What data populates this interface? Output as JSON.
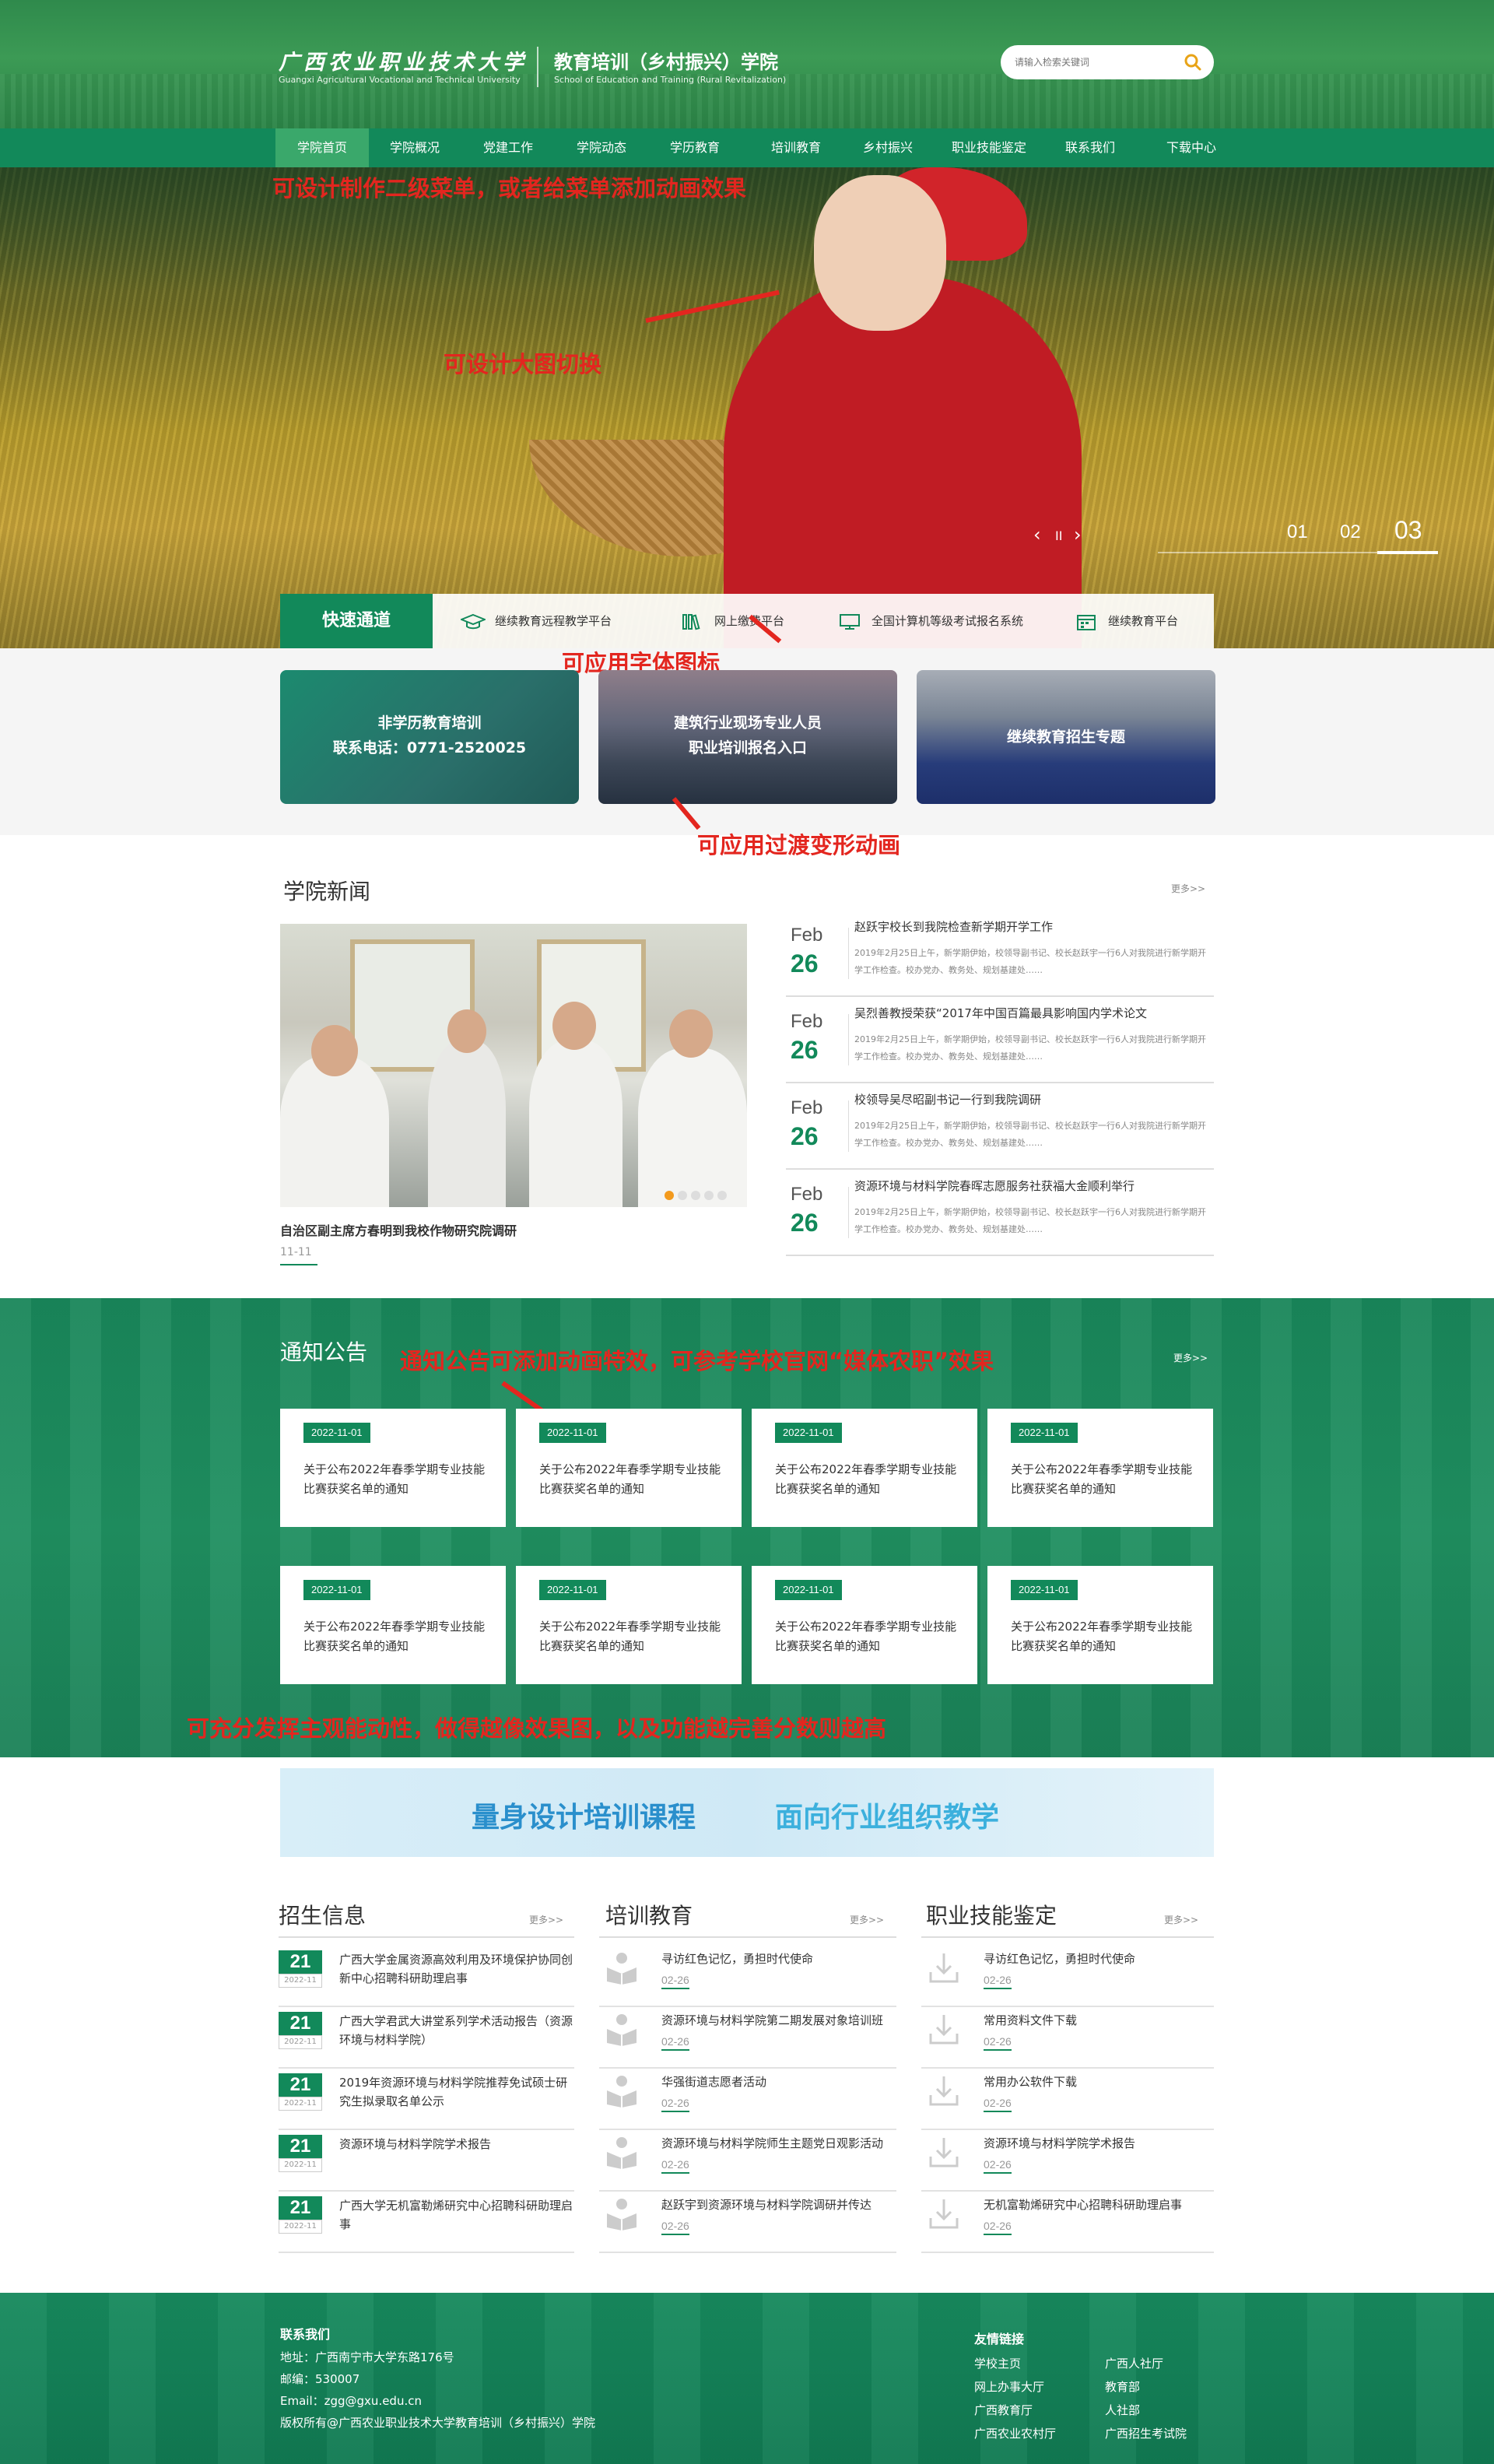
{
  "header": {
    "logo_cn": "广西农业职业技术大学",
    "logo_en": "Guangxi Agricultural Vocational and Technical University",
    "school_cn": "教育培训（乡村振兴）学院",
    "school_en": "School of Education and Training (Rural Revitalization)",
    "search_placeholder": "请输入检索关键词",
    "search_icon": "search-icon"
  },
  "nav": {
    "items": [
      {
        "label": "学院首页",
        "active": true
      },
      {
        "label": "学院概况"
      },
      {
        "label": "党建工作"
      },
      {
        "label": "学院动态"
      },
      {
        "label": "学历教育"
      },
      {
        "label": "培训教育"
      },
      {
        "label": "乡村振兴"
      },
      {
        "label": "职业技能鉴定"
      },
      {
        "label": "联系我们"
      },
      {
        "label": "下载中心"
      }
    ]
  },
  "annotations": {
    "menu_note": "可设计制作二级菜单，或者给菜单添加动画效果",
    "banner_note": "可设计大图切换",
    "icon_note": "可应用字体图标",
    "transition_note": "可应用过渡变形动画",
    "notice_note": "通知公告可添加动画特效，可参考学校官网“媒体农职”效果",
    "bottom_note": "可充分发挥主观能动性，做得越像效果图，以及功能越完善分数则越高"
  },
  "banner": {
    "prev": "‹",
    "pause": "II",
    "next": "›",
    "slides": [
      "01",
      "02",
      "03"
    ],
    "active_slide": "03"
  },
  "quick": {
    "title": "快速通道",
    "items": [
      {
        "label": "继续教育远程教学平台",
        "icon": "graduation-cap-icon"
      },
      {
        "label": "网上缴费平台",
        "icon": "books-icon"
      },
      {
        "label": "全国计算机等级考试报名系统",
        "icon": "presentation-icon"
      },
      {
        "label": "继续教育平台",
        "icon": "calendar-icon"
      }
    ]
  },
  "features": [
    {
      "line1": "非学历教育培训",
      "line2": "联系电话：0771-2520025"
    },
    {
      "line1": "建筑行业现场专业人员",
      "line2": "职业培训报名入口"
    },
    {
      "line1": "继续教育招生专题",
      "line2": ""
    }
  ],
  "news": {
    "title": "学院新闻",
    "more": "更多>>",
    "featured_caption": "自治区副主席方春明到我校作物研究院调研",
    "featured_date": "11-11",
    "items": [
      {
        "month": "Feb",
        "day": "26",
        "title": "赵跃宇校长到我院检查新学期开学工作",
        "desc": "2019年2月25日上午，新学期伊始，校领导副书记、校长赵跃宇一行6人对我院进行新学期开学工作检查。校办党办、教务处、规划基建处……"
      },
      {
        "month": "Feb",
        "day": "26",
        "title": "吴烈善教授荣获“2017年中国百篇最具影响国内学术论文",
        "desc": "2019年2月25日上午，新学期伊始，校领导副书记、校长赵跃宇一行6人对我院进行新学期开学工作检查。校办党办、教务处、规划基建处……"
      },
      {
        "month": "Feb",
        "day": "26",
        "title": "校领导吴尽昭副书记一行到我院调研",
        "desc": "2019年2月25日上午，新学期伊始，校领导副书记、校长赵跃宇一行6人对我院进行新学期开学工作检查。校办党办、教务处、规划基建处……"
      },
      {
        "month": "Feb",
        "day": "26",
        "title": "资源环境与材料学院春晖志愿服务社获福大金顺利举行",
        "desc": "2019年2月25日上午，新学期伊始，校领导副书记、校长赵跃宇一行6人对我院进行新学期开学工作检查。校办党办、教务处、规划基建处……"
      }
    ]
  },
  "notices": {
    "title": "通知公告",
    "more": "更多>>",
    "items": [
      {
        "date": "2022-11-01",
        "text": "关于公布2022年春季学期专业技能比赛获奖名单的通知"
      },
      {
        "date": "2022-11-01",
        "text": "关于公布2022年春季学期专业技能比赛获奖名单的通知"
      },
      {
        "date": "2022-11-01",
        "text": "关于公布2022年春季学期专业技能比赛获奖名单的通知"
      },
      {
        "date": "2022-11-01",
        "text": "关于公布2022年春季学期专业技能比赛获奖名单的通知"
      },
      {
        "date": "2022-11-01",
        "text": "关于公布2022年春季学期专业技能比赛获奖名单的通知"
      },
      {
        "date": "2022-11-01",
        "text": "关于公布2022年春季学期专业技能比赛获奖名单的通知"
      },
      {
        "date": "2022-11-01",
        "text": "关于公布2022年春季学期专业技能比赛获奖名单的通知"
      },
      {
        "date": "2022-11-01",
        "text": "关于公布2022年春季学期专业技能比赛获奖名单的通知"
      }
    ]
  },
  "promo": {
    "left": "量身设计培训课程",
    "right": "面向行业组织教学"
  },
  "admissions": {
    "title": "招生信息",
    "more": "更多>>",
    "items": [
      {
        "day": "21",
        "month": "2022-11",
        "title": "广西大学金属资源高效利用及环境保护协同创新中心招聘科研助理启事"
      },
      {
        "day": "21",
        "month": "2022-11",
        "title": "广西大学君武大讲堂系列学术活动报告（资源环境与材料学院）"
      },
      {
        "day": "21",
        "month": "2022-11",
        "title": "2019年资源环境与材料学院推荐免试硕士研究生拟录取名单公示"
      },
      {
        "day": "21",
        "month": "2022-11",
        "title": "资源环境与材料学院学术报告"
      },
      {
        "day": "21",
        "month": "2022-11",
        "title": "广西大学无机富勒烯研究中心招聘科研助理启事"
      }
    ]
  },
  "training": {
    "title": "培训教育",
    "more": "更多>>",
    "items": [
      {
        "title": "寻访红色记忆，勇担时代使命",
        "date": "02-26"
      },
      {
        "title": "资源环境与材料学院第二期发展对象培训班",
        "date": "02-26"
      },
      {
        "title": "华强街道志愿者活动",
        "date": "02-26"
      },
      {
        "title": "资源环境与材料学院师生主题党日观影活动",
        "date": "02-26"
      },
      {
        "title": "赵跃宇到资源环境与材料学院调研并传达",
        "date": "02-26"
      }
    ]
  },
  "skills": {
    "title": "职业技能鉴定",
    "more": "更多>>",
    "items": [
      {
        "title": "寻访红色记忆，勇担时代使命",
        "date": "02-26"
      },
      {
        "title": "常用资料文件下载",
        "date": "02-26"
      },
      {
        "title": "常用办公软件下载",
        "date": "02-26"
      },
      {
        "title": "资源环境与材料学院学术报告",
        "date": "02-26"
      },
      {
        "title": "无机富勒烯研究中心招聘科研助理启事",
        "date": "02-26"
      }
    ]
  },
  "footer": {
    "contact_title": "联系我们",
    "address": "地址：广西南宁市大学东路176号",
    "postcode": "邮编：530007",
    "email": "Email：zgg@gxu.edu.cn",
    "copyright": "版权所有@广西农业职业技术大学教育培训（乡村振兴）学院",
    "links_title": "友情链接",
    "links": [
      "学校主页",
      "广西人社厅",
      "网上办事大厅",
      "教育部",
      "广西教育厅",
      "人社部",
      "广西农业农村厅",
      "广西招生考试院"
    ]
  },
  "colors": {
    "primary": "#12895a",
    "accent_red": "#e3261f",
    "nav_active": "#3aa86b"
  }
}
